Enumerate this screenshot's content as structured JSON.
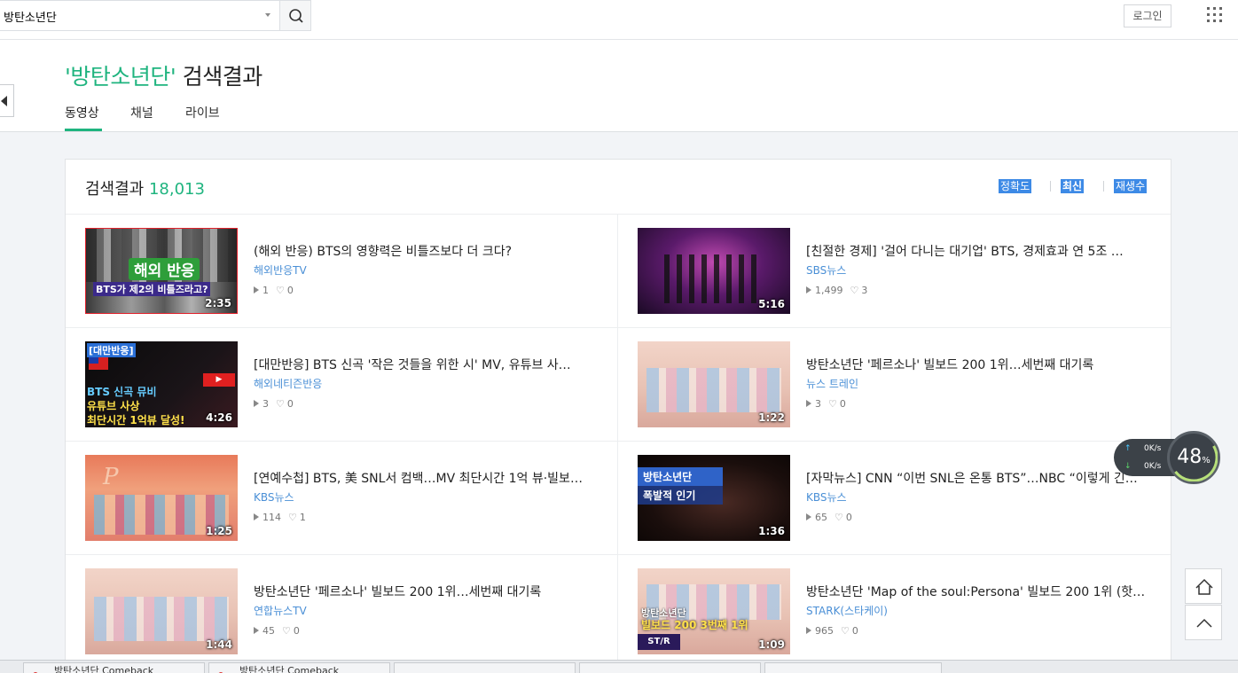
{
  "search": {
    "query": "방탄소년단"
  },
  "header": {
    "login_label": "로그인",
    "title_keyword": "'방탄소년단'",
    "title_suffix": " 검색결과",
    "tabs": [
      {
        "label": "동영상"
      },
      {
        "label": "채널"
      },
      {
        "label": "라이브"
      }
    ]
  },
  "results": {
    "count_label": "검색결과 ",
    "count": "18,013",
    "sort_options": [
      {
        "label": "정확도"
      },
      {
        "label": "최신"
      },
      {
        "label": "재생수"
      }
    ],
    "items": [
      {
        "title": "(해외 반응) BTS의 영향력은 비틀즈보다 더 크다?",
        "channel": "해외반응TV",
        "plays": "1",
        "likes": "0",
        "duration": "2:35",
        "overlay": "해외 반응",
        "overlay2": "BTS가 제2의 비틀즈라고?"
      },
      {
        "title": "[친절한 경제] '걸어 다니는 대기업' BTS, 경제효과 연 5조 …",
        "channel": "SBS뉴스",
        "plays": "1,499",
        "likes": "3",
        "duration": "5:16"
      },
      {
        "title": "[대만반응] BTS 신곡 '작은 것들을 위한 시' MV, 유튜브 사…",
        "channel": "해외네티즌반응",
        "plays": "3",
        "likes": "0",
        "duration": "4:26",
        "overlay": "[대만반응]",
        "overlay2": "BTS 신곡 뮤비",
        "overlay3": "유튜브 사상",
        "overlay4": "최단시간 1억뷰 달성!"
      },
      {
        "title": "방탄소년단 '페르소나' 빌보드 200 1위…세번째 대기록",
        "channel": "뉴스 트레인",
        "plays": "3",
        "likes": "0",
        "duration": "1:22"
      },
      {
        "title": "[연예수첩] BTS, 美 SNL서 컴백…MV 최단시간 1억 뷰·빌보…",
        "channel": "KBS뉴스",
        "plays": "114",
        "likes": "1",
        "duration": "1:25"
      },
      {
        "title": "[자막뉴스] CNN “이번 SNL은 온통 BTS”…NBC “이렇게 긴…",
        "channel": "KBS뉴스",
        "plays": "65",
        "likes": "0",
        "duration": "1:36",
        "overlay": "방탄소년단",
        "overlay2": "폭발적 인기"
      },
      {
        "title": "방탄소년단 '페르소나' 빌보드 200 1위…세번째 대기록",
        "channel": "연합뉴스TV",
        "plays": "45",
        "likes": "0",
        "duration": "1:44"
      },
      {
        "title": "방탄소년단 'Map of the soul:Persona' 빌보드 200 1위 (핫…",
        "channel": "STARK(스타케이)",
        "plays": "965",
        "likes": "0",
        "duration": "1:09",
        "overlay": "방탄소년단",
        "overlay2": "빌보드 200 3번째 1위"
      }
    ]
  },
  "widgets": {
    "upload_speed": "0K/s",
    "download_speed": "0K/s",
    "gauge_value": "48",
    "gauge_unit": "%"
  },
  "taskbar": {
    "tabs": [
      {
        "label": "방탄소년단 Comeback"
      },
      {
        "label": "방탄소년단 Comeback"
      }
    ]
  },
  "colors": {
    "accent": "#1fb47f",
    "link": "#4a8fd6",
    "sort_bg": "#3d8ae6"
  }
}
